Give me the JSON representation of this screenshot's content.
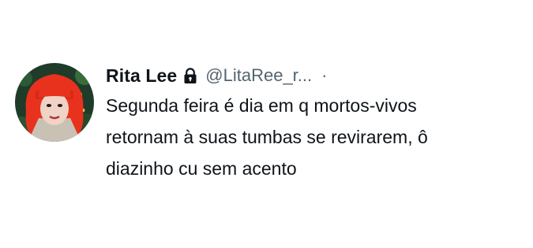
{
  "tweet": {
    "author": {
      "display_name": "Rita Lee",
      "handle": "@LitaRee_r...",
      "separator": "·",
      "avatar_icon": "profile-photo-red-hair",
      "protected_icon": "lock-icon"
    },
    "text_lines": [
      "Segunda feira é dia em q mortos-vivos",
      "retornam à suas tumbas se revirarem, ô",
      "diazinho cu sem acento"
    ]
  },
  "colors": {
    "background": "#ffffff",
    "name_text": "#0f1419",
    "secondary_text": "#536471",
    "hair_red": "#e8321e"
  }
}
